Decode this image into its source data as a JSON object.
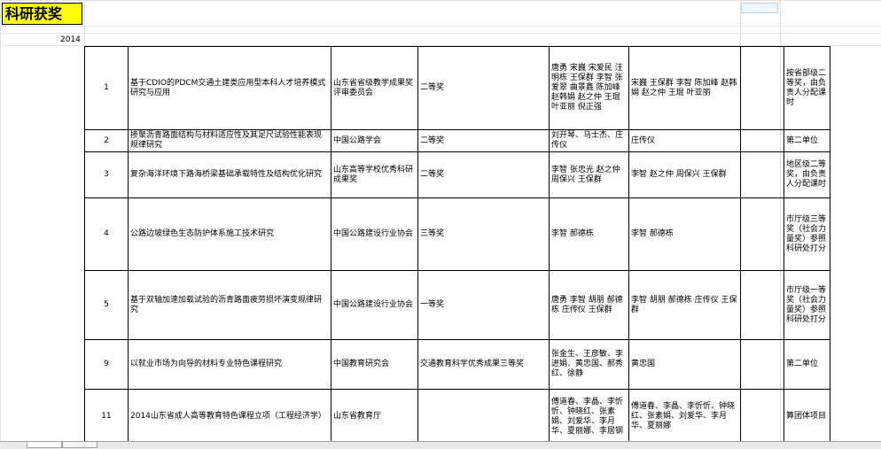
{
  "sheet": {
    "title": "科研获奖",
    "year": "2014"
  },
  "rows": [
    {
      "no": "1",
      "project": "基于CDIO的PDCM交通土建类应用型本科人才培养模式研究与应用",
      "issuer": "山东省省级教学成果奖评审委员会",
      "level": "二等奖",
      "people": "唐勇 宋巍 宋爱民 汪明栋 王保群 李智 张爱翠 曲景鑫 陈加峰 赵韩娟 赵之仲 王琨 叶亚丽 倪正强",
      "members": "宋巍 王保群 李智 陈加峰 赵韩娟 赵之仲 王琨 叶亚丽",
      "note": "按省部级二等奖，由负责人分配课时"
    },
    {
      "no": "2",
      "project": "掺聚沥青路面结构与材料适应性及其足尺试验性能表现规律研究",
      "issuer": "中国公路学会",
      "level": "二等奖",
      "people": "刘开琴、马士杰、庄传仪",
      "members": "庄传仪",
      "note": "第二单位"
    },
    {
      "no": "3",
      "project": "复杂海洋环境下路海桥梁基础承载特性及结构优化研究",
      "issuer": "山东高等学校优秀科研成果奖",
      "level": "二等奖",
      "people": "李智 张忠光 赵之仲 周保兴 王保群",
      "members": "李智 赵之仲 周保兴 王保群",
      "note": "地区级二等奖，由负责人分配课时"
    },
    {
      "no": "4",
      "project": "公路边坡绿色生态防护体系施工技术研究",
      "issuer": "中国公路建设行业协会",
      "level": "三等奖",
      "people": "李智 郝德栋",
      "members": "李智 郝德栋",
      "note": "市厅级三等奖（社会力量奖）参照科研处打分"
    },
    {
      "no": "5",
      "project": "基于双轴加速加载试验的沥青路面疲劳损坏演变规律研究",
      "issuer": "中国公路建设行业协会",
      "level": "一等奖",
      "people": "唐勇 李智 胡朋 郝德栋 庄传仪 王保群",
      "members": "李智 胡朋 郝德栋 庄传仪 王保群",
      "note": "市厅级一等奖（社会力量奖）参照科研处打分"
    },
    {
      "no": "9",
      "project": "以就业市场为向导的材料专业特色课程研究",
      "issuer": "中国教育研究会",
      "level": "交通教育科学优秀成果三等奖",
      "people": "张金生、王彦敏、李进娟、黄忠国、郝秀红、徐静",
      "members": "黄忠国",
      "note": "第二单位"
    },
    {
      "no": "11",
      "project": "2014山东省成人高等教育特色课程立项（工程经济学）",
      "issuer": "山东省教育厅",
      "level": "",
      "people": "傅道春、李晶、李忻忻、钟晓红、张素娟、刘爱华、李月华、夏丽娜、李居钢",
      "members": "傅道春、李晶、李忻忻、钟晓红、张素娟、刘爱华、李月华、夏丽娜",
      "note": "算团体项目"
    }
  ]
}
